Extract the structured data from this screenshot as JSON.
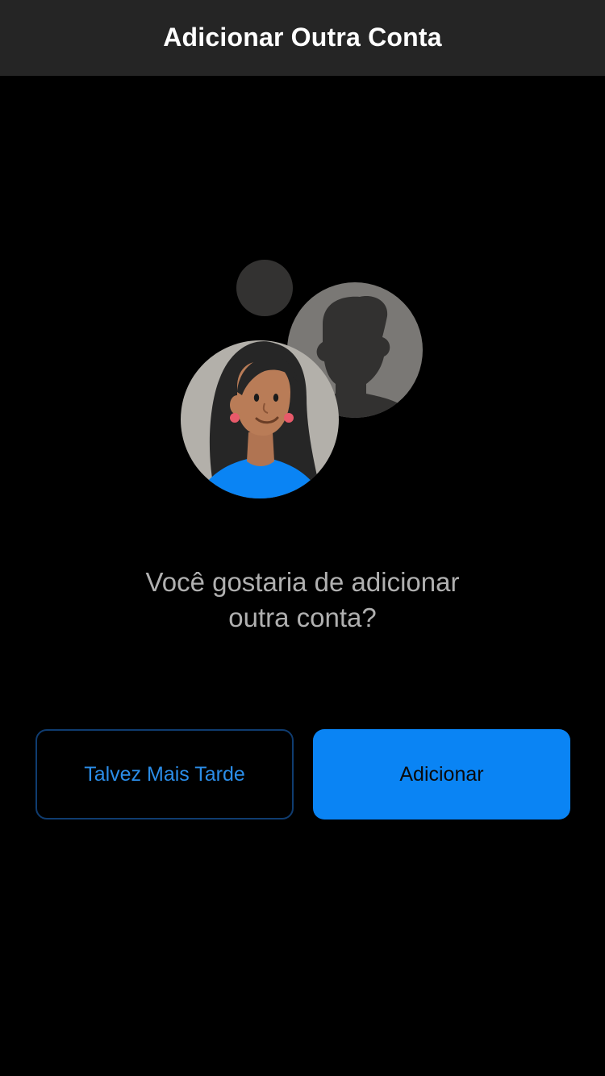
{
  "header": {
    "title": "Adicionar Outra Conta"
  },
  "illustration": {
    "icon": "add-account-people-illustration",
    "colors": {
      "small_dot": "#333231",
      "silhouette_bg": "#7a7875",
      "silhouette": "#323130",
      "avatar_bg": "#b3b0aa",
      "hair": "#2a2a2a",
      "skin": "#b97c57",
      "shirt": "#0a84f4",
      "earring": "#e85a6a"
    }
  },
  "prompt": {
    "line1": "Você gostaria de adicionar",
    "line2": "outra conta?"
  },
  "actions": {
    "later_label": "Talvez Mais Tarde",
    "add_label": "Adicionar"
  },
  "colors": {
    "background": "#000000",
    "nav_bar": "#252525",
    "accent": "#0a84f4",
    "secondary_text": "#b0b0b0"
  }
}
